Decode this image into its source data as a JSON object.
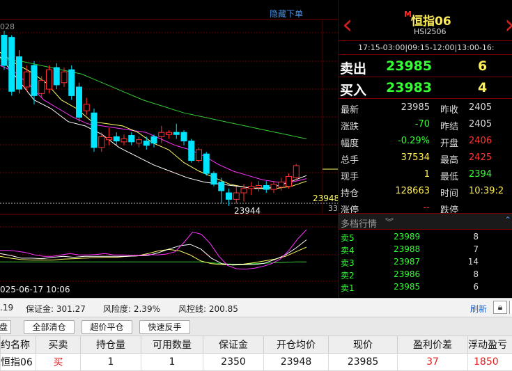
{
  "chart": {
    "hide_orders_label": "隐藏下单",
    "top_left_price": "028",
    "last_price_tag": "23948",
    "right_tag_33": "33",
    "low_label": "23944",
    "date_label": "025-06-17 10:06",
    "colors": {
      "up": "#ff3333",
      "down": "#00e5ff",
      "ma_fast": "#ffffff",
      "ma_mid": "#ffff66",
      "ma_slow1": "#ff33ff",
      "ma_slow2": "#33cc33"
    }
  },
  "chart_data": {
    "type": "candlestick",
    "candles": [
      {
        "o": 24250,
        "c": 24180,
        "h": 24260,
        "l": 24170
      },
      {
        "o": 24245,
        "c": 24120,
        "h": 24250,
        "l": 24110
      },
      {
        "o": 24200,
        "c": 24125,
        "h": 24215,
        "l": 24115
      },
      {
        "o": 24130,
        "c": 24165,
        "h": 24180,
        "l": 24120
      },
      {
        "o": 24180,
        "c": 24110,
        "h": 24190,
        "l": 24090
      },
      {
        "o": 24115,
        "c": 24145,
        "h": 24155,
        "l": 24105
      },
      {
        "o": 24125,
        "c": 24170,
        "h": 24180,
        "l": 24115
      },
      {
        "o": 24175,
        "c": 24135,
        "h": 24185,
        "l": 24125
      },
      {
        "o": 24140,
        "c": 24165,
        "h": 24175,
        "l": 24130
      },
      {
        "o": 24170,
        "c": 24110,
        "h": 24180,
        "l": 24100
      },
      {
        "o": 24130,
        "c": 24060,
        "h": 24140,
        "l": 24050
      },
      {
        "o": 24075,
        "c": 24090,
        "h": 24105,
        "l": 24065
      },
      {
        "o": 24070,
        "c": 23990,
        "h": 24080,
        "l": 23980
      },
      {
        "o": 23990,
        "c": 24015,
        "h": 24025,
        "l": 23980
      },
      {
        "o": 24008,
        "c": 24013,
        "h": 24035,
        "l": 23995
      },
      {
        "o": 24015,
        "c": 24005,
        "h": 24025,
        "l": 23995
      },
      {
        "o": 24003,
        "c": 24010,
        "h": 24020,
        "l": 23995
      },
      {
        "o": 24018,
        "c": 24003,
        "h": 24025,
        "l": 23995
      },
      {
        "o": 24000,
        "c": 24008,
        "h": 24015,
        "l": 23990
      },
      {
        "o": 24005,
        "c": 23995,
        "h": 24015,
        "l": 23985
      },
      {
        "o": 24015,
        "c": 24000,
        "h": 24020,
        "l": 23990
      },
      {
        "o": 24015,
        "c": 24025,
        "h": 24040,
        "l": 24000
      },
      {
        "o": 24020,
        "c": 24025,
        "h": 24030,
        "l": 24010
      },
      {
        "o": 24025,
        "c": 24020,
        "h": 24045,
        "l": 24010
      },
      {
        "o": 24025,
        "c": 24005,
        "h": 24030,
        "l": 23995
      },
      {
        "o": 24005,
        "c": 23960,
        "h": 24010,
        "l": 23955
      },
      {
        "o": 23960,
        "c": 23985,
        "h": 23990,
        "l": 23955
      },
      {
        "o": 23975,
        "c": 23930,
        "h": 23980,
        "l": 23925
      },
      {
        "o": 23930,
        "c": 23905,
        "h": 23935,
        "l": 23900
      },
      {
        "o": 23910,
        "c": 23890,
        "h": 23920,
        "l": 23860
      },
      {
        "o": 23885,
        "c": 23870,
        "h": 23895,
        "l": 23855
      },
      {
        "o": 23870,
        "c": 23885,
        "h": 23900,
        "l": 23860
      },
      {
        "o": 23885,
        "c": 23895,
        "h": 23905,
        "l": 23865
      },
      {
        "o": 23895,
        "c": 23900,
        "h": 23910,
        "l": 23880
      },
      {
        "o": 23897,
        "c": 23902,
        "h": 23912,
        "l": 23888
      },
      {
        "o": 23902,
        "c": 23893,
        "h": 23912,
        "l": 23885
      },
      {
        "o": 23893,
        "c": 23905,
        "h": 23912,
        "l": 23885
      },
      {
        "o": 23898,
        "c": 23910,
        "h": 23920,
        "l": 23890
      },
      {
        "o": 23900,
        "c": 23923,
        "h": 23930,
        "l": 23895
      },
      {
        "o": 23920,
        "c": 23948,
        "h": 23952,
        "l": 23912
      }
    ],
    "ma_fast": [
      24200,
      24150,
      24100,
      24080,
      24050,
      24040,
      24020,
      23990,
      23970,
      23950,
      23935,
      23920,
      23910,
      23905,
      23900,
      23895,
      23898,
      23910,
      23925
    ],
    "ma_mid": [
      24210,
      24185,
      24165,
      24140,
      24100,
      24080,
      24050,
      24045,
      24040,
      24025,
      24000,
      23985,
      23955,
      23935,
      23920,
      23905,
      23898,
      23895,
      23895,
      23900,
      23912
    ],
    "ma_slow1": [
      24180,
      24165,
      24135,
      24100,
      24080,
      24060,
      24045,
      24040,
      24035,
      24030,
      24025,
      24010,
      23995,
      23985,
      23970,
      23950,
      23935,
      23925,
      23915,
      23910,
      23910,
      23918
    ],
    "ma_slow2": [
      24195,
      24190,
      24180,
      24170,
      24160,
      24140,
      24120,
      24100,
      24085,
      24070,
      24060,
      24050,
      24040,
      24030,
      24020,
      24010
    ],
    "osc1": [
      0.55,
      0.55,
      0.53,
      0.5,
      0.45,
      0.42,
      0.42,
      0.45,
      0.48,
      0.45,
      0.45,
      0.46,
      0.48,
      0.45,
      0.45,
      0.44,
      0.44,
      0.46,
      0.45,
      0.47,
      0.52,
      0.72,
      0.95,
      0.9,
      0.7,
      0.42,
      0.22,
      0.15,
      0.14,
      0.16,
      0.2,
      0.26,
      0.36,
      0.55,
      0.8,
      1.0
    ],
    "osc2": [
      0.48,
      0.44,
      0.38,
      0.38,
      0.37,
      0.4,
      0.42,
      0.4,
      0.42,
      0.42,
      0.42,
      0.42,
      0.42,
      0.43,
      0.44,
      0.5,
      0.58,
      0.65,
      0.68,
      0.58,
      0.38,
      0.26,
      0.23,
      0.24,
      0.24,
      0.27,
      0.35,
      0.45,
      0.6,
      0.78
    ],
    "osc3": [
      0.42,
      0.38,
      0.35,
      0.34,
      0.34,
      0.34,
      0.36,
      0.37,
      0.38,
      0.39,
      0.4,
      0.4,
      0.42,
      0.43,
      0.48,
      0.54,
      0.57,
      0.54,
      0.45,
      0.32,
      0.26,
      0.24,
      0.24,
      0.25,
      0.28,
      0.32,
      0.36,
      0.42,
      0.52,
      0.62
    ],
    "osc4": [
      0.3,
      0.3,
      0.3,
      0.3,
      0.3,
      0.3,
      0.3,
      0.3,
      0.3,
      0.3,
      0.3,
      0.3,
      0.3,
      0.3,
      0.3,
      0.3,
      0.3,
      0.3,
      0.3,
      0.3,
      0.28,
      0.26,
      0.25,
      0.25,
      0.26,
      0.27,
      0.28,
      0.29,
      0.3,
      0.3
    ],
    "last_price": 23948,
    "low_price": 23944
  },
  "quote": {
    "prev_arrow": "‹",
    "badge": "M",
    "title": "恒指06",
    "code": "HSI2506",
    "hours": "17:15-03:00|09:15-12:00|13:00-16:",
    "ask_label": "卖出",
    "ask_price": "23985",
    "ask_qty": "6",
    "bid_label": "买入",
    "bid_price": "23983",
    "bid_qty": "4",
    "rows": [
      {
        "l1": "最新",
        "v1": "23985",
        "l2": "昨收",
        "v2": "2405"
      },
      {
        "l1": "涨跌",
        "v1": "-70",
        "l2": "昨结",
        "v2": "2405"
      },
      {
        "l1": "幅度",
        "v1": "-0.29%",
        "l2": "开盘",
        "v2": "2406"
      },
      {
        "l1": "总手",
        "v1": "37534",
        "l2": "最高",
        "v2": "2425"
      },
      {
        "l1": "现手",
        "v1": "1",
        "l2": "最低",
        "v2": "2394"
      },
      {
        "l1": "持仓",
        "v1": "128663",
        "l2": "时间",
        "v2": "10:39:2"
      },
      {
        "l1": "涨停",
        "v1": "--",
        "l2": "跌停",
        "v2": ""
      }
    ],
    "depth_title": "多档行情",
    "depth_rows": [
      {
        "label": "卖5",
        "price": "23989",
        "qty": "8"
      },
      {
        "label": "卖4",
        "price": "23988",
        "qty": "7"
      },
      {
        "label": "卖3",
        "price": "23987",
        "qty": "14"
      },
      {
        "label": "卖2",
        "price": "23986",
        "qty": "8"
      },
      {
        "label": "卖1",
        "price": "23985",
        "qty": "6"
      }
    ]
  },
  "status": {
    "left_value": ".19",
    "margin": "保证金: 301.27",
    "risk": "风险度: 2.39%",
    "risk_line": "风控线: 200.85",
    "refresh": "刷新"
  },
  "toolbar": {
    "b0": "盘",
    "b1": "全部清仓",
    "b2": "超价平仓",
    "b3": "快速反手"
  },
  "positions": {
    "headers": [
      "约名称",
      "买卖",
      "持仓量",
      "可用数量",
      "保证金",
      "开仓均价",
      "现价",
      "盈利价差",
      "浮动盈亏"
    ],
    "row": [
      "恒指06",
      "买",
      "1",
      "1",
      "2350",
      "23948",
      "23985",
      "37",
      "1850"
    ]
  }
}
